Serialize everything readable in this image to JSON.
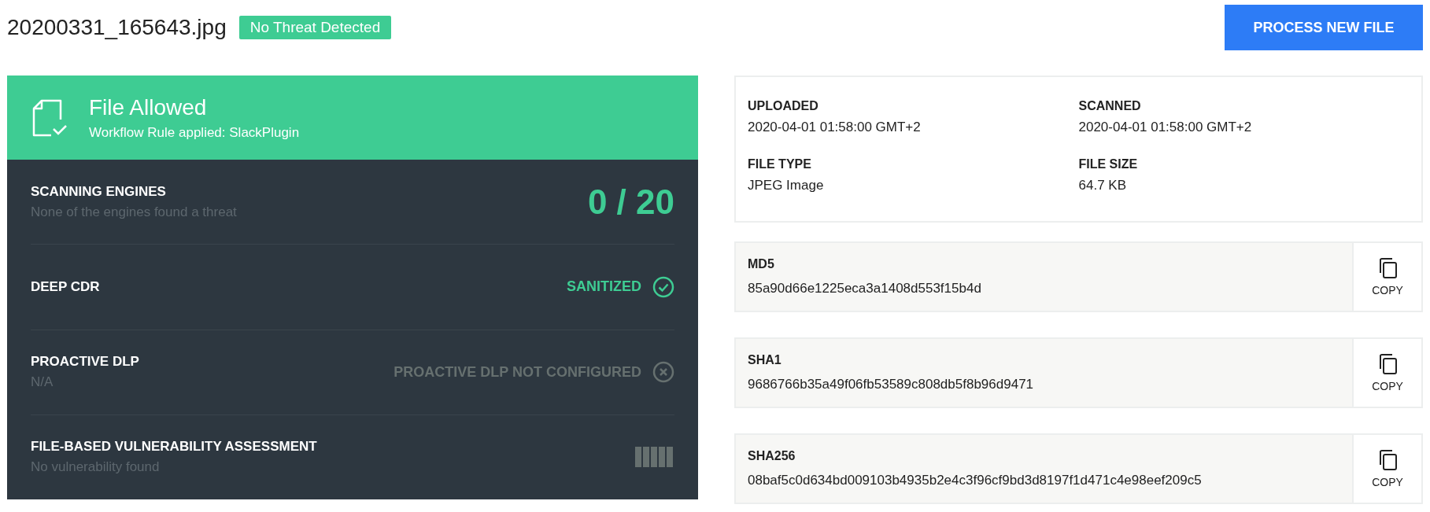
{
  "file_name": "20200331_165643.jpg",
  "verdict_badge": "No Threat Detected",
  "process_button": "PROCESS NEW FILE",
  "result_banner": {
    "title": "File Allowed",
    "subtitle": "Workflow Rule applied: SlackPlugin"
  },
  "checks": [
    {
      "kind": "count",
      "label": "SCANNING ENGINES",
      "detail": "None of the engines found a threat",
      "result": "0 / 20"
    },
    {
      "kind": "status",
      "label": "DEEP CDR",
      "result": "SANITIZED",
      "ok": true
    },
    {
      "kind": "status",
      "label": "PROACTIVE DLP",
      "detail": "N/A",
      "result": "PROACTIVE DLP NOT CONFIGURED",
      "ok": false
    },
    {
      "kind": "meter",
      "label": "FILE-BASED VULNERABILITY ASSESSMENT",
      "detail": "No vulnerability found"
    }
  ],
  "file_info": [
    {
      "label": "UPLOADED",
      "value": "2020-04-01 01:58:00 GMT+2"
    },
    {
      "label": "SCANNED",
      "value": "2020-04-01 01:58:00 GMT+2"
    },
    {
      "label": "FILE TYPE",
      "value": "JPEG Image"
    },
    {
      "label": "FILE SIZE",
      "value": "64.7 KB"
    }
  ],
  "hashes": [
    {
      "label": "MD5",
      "value": "85a90d66e1225eca3a1408d553f15b4d",
      "button": "COPY"
    },
    {
      "label": "SHA1",
      "value": "9686766b35a49f06fb53589c808db5f8b96d9471",
      "button": "COPY"
    },
    {
      "label": "SHA256",
      "value": "08baf5c0d634bd009103b4935b2e4c3f96cf9bd3d8197f1d471c4e98eef209c5",
      "button": "COPY"
    }
  ]
}
